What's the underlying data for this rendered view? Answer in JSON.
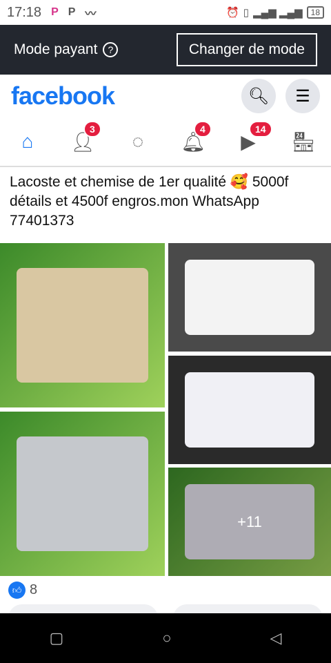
{
  "status": {
    "time": "17:18",
    "battery": "18"
  },
  "mode_bar": {
    "label": "Mode payant",
    "help": "?",
    "button": "Changer de mode"
  },
  "header": {
    "logo": "facebook"
  },
  "nav": {
    "friends_badge": "3",
    "notifications_badge": "4",
    "video_badge": "14"
  },
  "post": {
    "text": "Lacoste et chemise de 1er qualité 🥰 5000f détails et 4500f engros.mon WhatsApp 77401373",
    "more_photos": "+11",
    "reaction_count": "8"
  },
  "colors": {
    "brand": "#1877f2",
    "badge": "#e41e3f",
    "mode_bar": "#23272f"
  }
}
